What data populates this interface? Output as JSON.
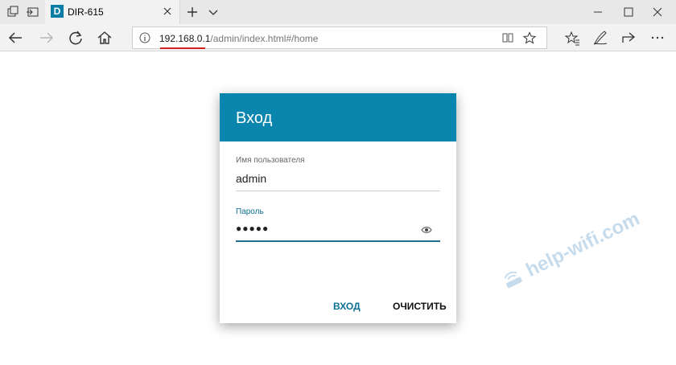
{
  "tab": {
    "favicon_letter": "D",
    "title": "DIR-615"
  },
  "address": {
    "host": "192.168.0.1",
    "path": "/admin/index.html#/home"
  },
  "login": {
    "title": "Вход",
    "username_label": "Имя пользователя",
    "username_value": "admin",
    "password_label": "Пароль",
    "password_value": "●●●●●",
    "login_button": "ВХОД",
    "clear_button": "ОЧИСТИТЬ"
  },
  "watermark": "help-wifi.com",
  "colors": {
    "header": "#0a86ae",
    "accent_text": "#0a6f92",
    "url_underline": "#d42020"
  }
}
